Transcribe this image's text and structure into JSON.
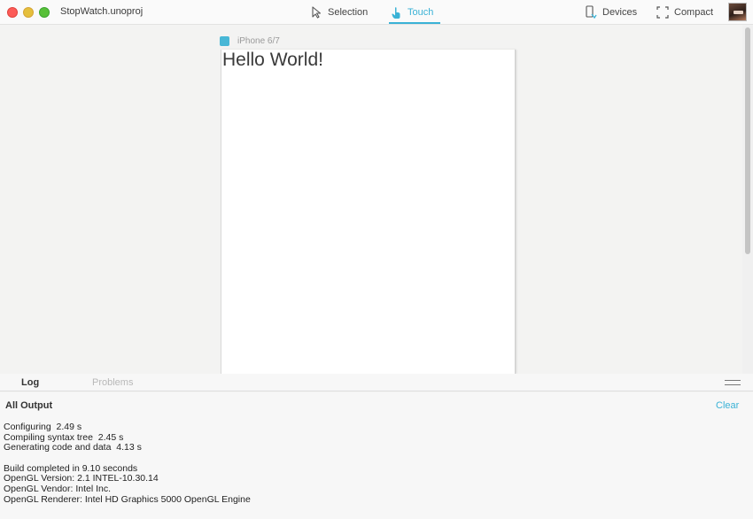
{
  "window": {
    "title": "StopWatch.unoproj"
  },
  "toolbar": {
    "selection_label": "Selection",
    "touch_label": "Touch",
    "devices_label": "Devices",
    "compact_label": "Compact",
    "active_mode": "Touch",
    "accent_color": "#3ab2d6"
  },
  "preview": {
    "device_name": "iPhone 6/7",
    "app_text": "Hello World!"
  },
  "panel": {
    "tabs": [
      "Log",
      "Problems"
    ],
    "active_tab": "Log",
    "output_title": "All Output",
    "clear_label": "Clear",
    "log_lines": [
      "Configuring  2.49 s",
      "Compiling syntax tree  2.45 s",
      "Generating code and data  4.13 s",
      "",
      "Build completed in 9.10 seconds",
      "OpenGL Version: 2.1 INTEL-10.30.14",
      "OpenGL Vendor: Intel Inc.",
      "OpenGL Renderer: Intel HD Graphics 5000 OpenGL Engine"
    ]
  }
}
